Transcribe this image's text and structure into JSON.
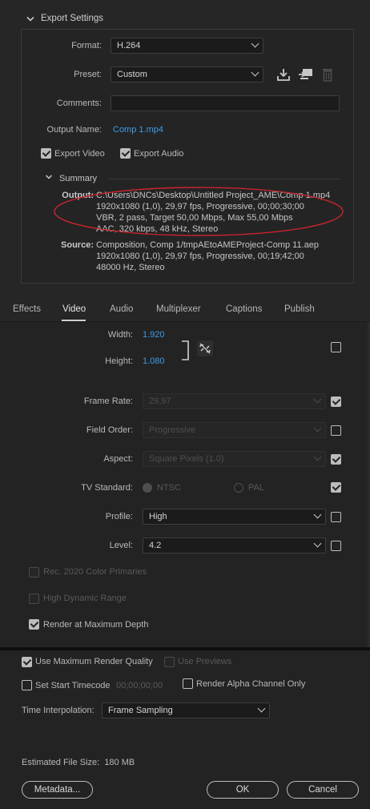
{
  "export_settings": {
    "header": "Export Settings",
    "format_label": "Format:",
    "format_value": "H.264",
    "preset_label": "Preset:",
    "preset_value": "Custom",
    "comments_label": "Comments:",
    "comments_value": "",
    "output_name_label": "Output Name:",
    "output_name_value": "Comp 1.mp4",
    "export_video_label": "Export Video",
    "export_video_checked": true,
    "export_audio_label": "Export Audio",
    "export_audio_checked": true,
    "summary_label": "Summary",
    "output_head": "Output:",
    "output_lines": [
      "C:\\Users\\DNCs\\Desktop\\Untitled Project_AME\\Comp 1.mp4",
      "1920x1080 (1,0), 29,97 fps, Progressive, 00;00;30;00",
      "VBR, 2 pass, Target 50,00 Mbps, Max 55,00 Mbps",
      "AAC, 320 kbps, 48 kHz, Stereo"
    ],
    "source_head": "Source:",
    "source_lines": [
      "Composition, Comp 1/tmpAEtoAMEProject-Comp 11.aep",
      "1920x1080 (1,0), 29,97 fps, Progressive, 00;19;42;00",
      "48000 Hz, Stereo"
    ]
  },
  "tabs": [
    "Effects",
    "Video",
    "Audio",
    "Multiplexer",
    "Captions",
    "Publish"
  ],
  "active_tab": "Video",
  "video": {
    "width_label": "Width:",
    "width_value": "1.920",
    "height_label": "Height:",
    "height_value": "1.080",
    "frame_rate_label": "Frame Rate:",
    "frame_rate_value": "29,97",
    "field_order_label": "Field Order:",
    "field_order_value": "Progressive",
    "aspect_label": "Aspect:",
    "aspect_value": "Square Pixels (1.0)",
    "tv_standard_label": "TV Standard:",
    "ntsc_label": "NTSC",
    "pal_label": "PAL",
    "profile_label": "Profile:",
    "profile_value": "High",
    "level_label": "Level:",
    "level_value": "4.2",
    "rec2020_label": "Rec. 2020 Color Primaries",
    "hdr_label": "High Dynamic Range",
    "render_max_depth_label": "Render at Maximum Depth"
  },
  "bottom": {
    "use_max_render_quality_label": "Use Maximum Render Quality",
    "use_previews_label": "Use Previews",
    "set_start_timecode_label": "Set Start Timecode",
    "start_timecode_value": "00;00;00;00",
    "render_alpha_label": "Render Alpha Channel Only",
    "time_interpolation_label": "Time Interpolation:",
    "time_interpolation_value": "Frame Sampling",
    "estimated_file_size": "Estimated File Size:  180 MB",
    "metadata_button": "Metadata...",
    "ok_button": "OK",
    "cancel_button": "Cancel"
  },
  "colors": {
    "accent_blue": "#3f9ae9",
    "highlight_red": "#c8252d",
    "background": "#232323"
  }
}
